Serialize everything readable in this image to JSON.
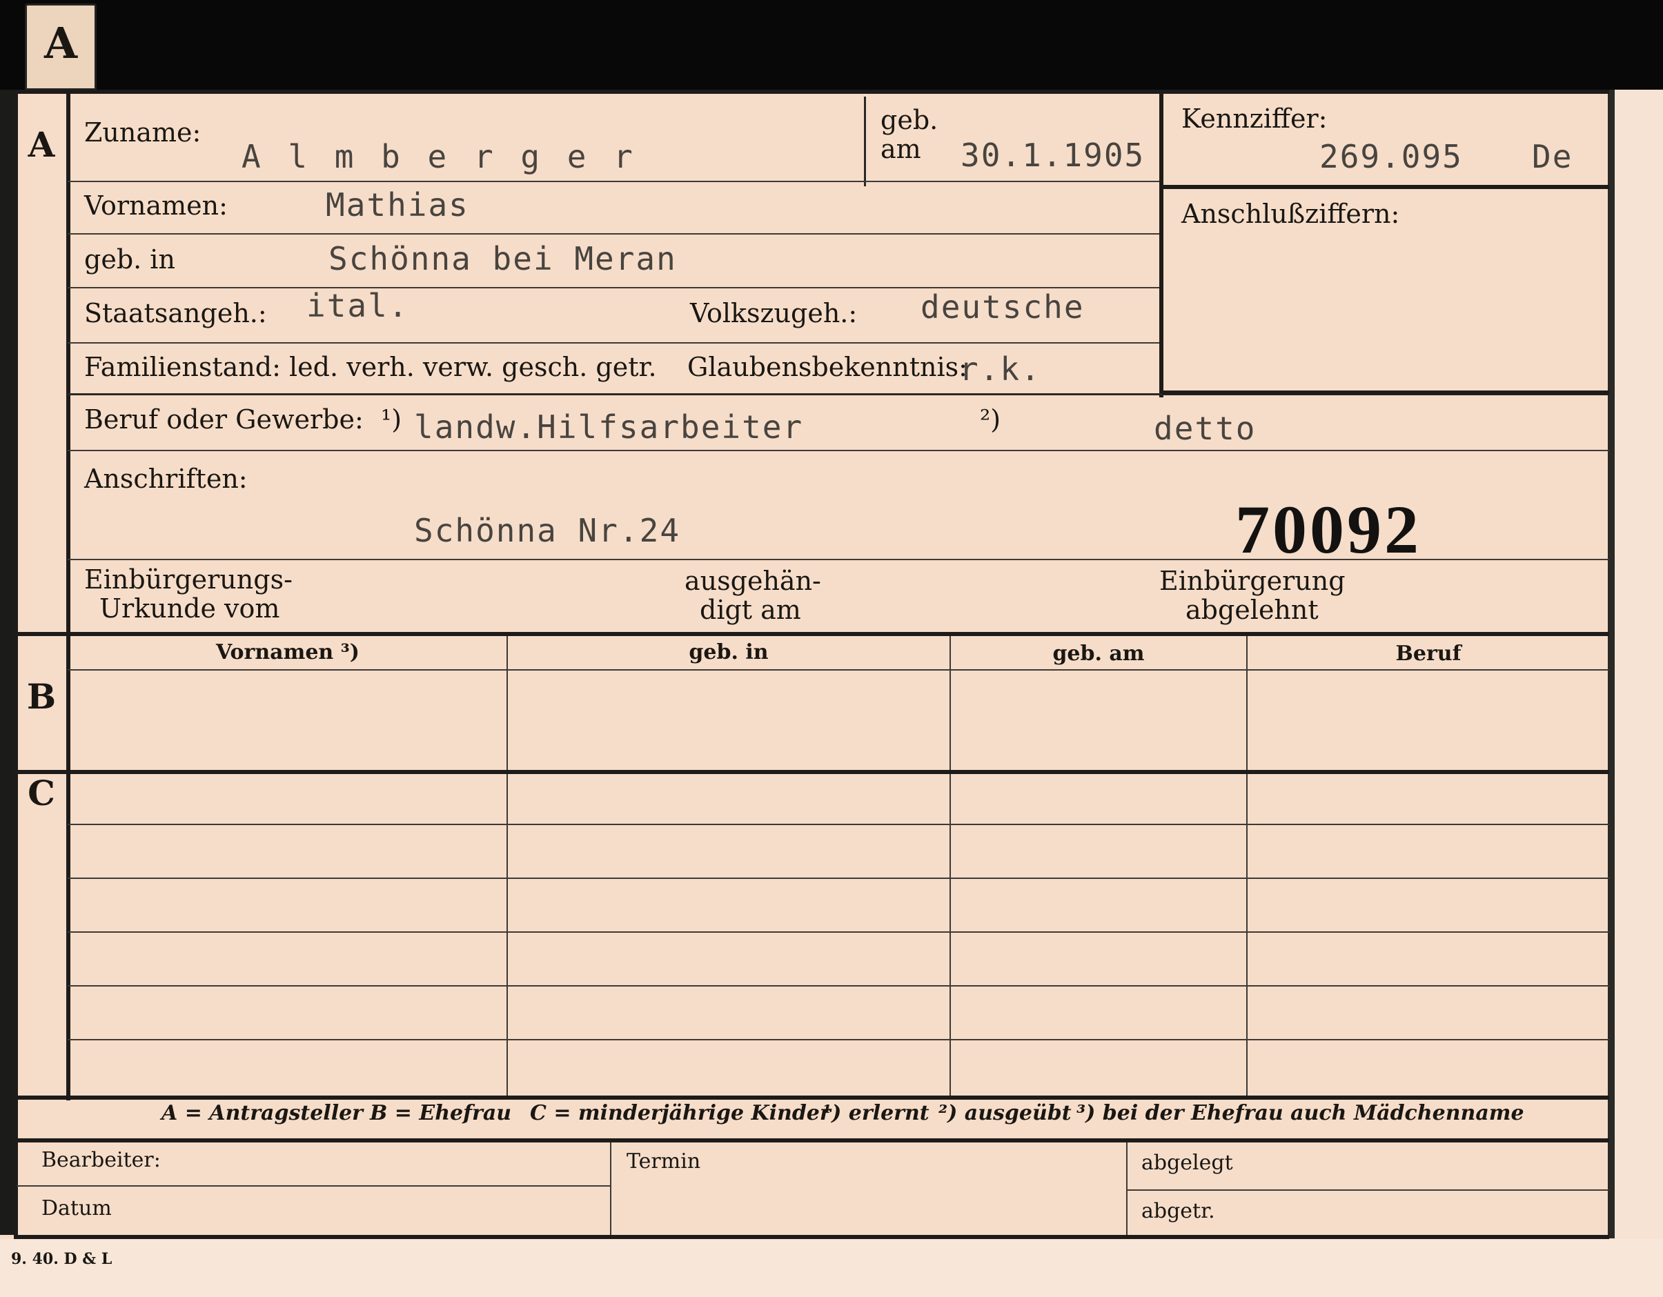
{
  "tab": {
    "letter": "A"
  },
  "sections": {
    "a": "A",
    "b": "B",
    "c": "C"
  },
  "applicant": {
    "surname": {
      "label": "Zuname:",
      "value": "A l m b e r g e r"
    },
    "birth_date": {
      "label_top": "geb.",
      "label_bottom": "am",
      "value": "30.1.1905"
    },
    "reference": {
      "label": "Kennziffer:",
      "value": "269.095",
      "suffix": "De"
    },
    "linked_numbers": {
      "label": "Anschlußziffern:"
    },
    "first_names": {
      "label": "Vornamen:",
      "value": "Mathias"
    },
    "birthplace": {
      "label": "geb. in",
      "value": "Schönna bei Meran"
    },
    "citizenship": {
      "label": "Staatsangeh.:",
      "value": "ital."
    },
    "ethnicity": {
      "label": "Volkszugeh.:",
      "value": "deutsche"
    },
    "marital_status": {
      "label": "Familienstand: led. verh. verw. gesch. getr."
    },
    "religion": {
      "label": "Glaubensbekenntnis:",
      "value": "r.k."
    },
    "occupation": {
      "label": "Beruf oder Gewerbe:",
      "note1": "¹)",
      "value1": "landw.Hilfsarbeiter",
      "note2": "²)",
      "value2": "detto"
    },
    "addresses": {
      "label": "Anschriften:",
      "value": "Schönna Nr.24"
    },
    "stamp_number": "70092",
    "naturalization": {
      "certificate_line1": "Einbürgerungs-",
      "certificate_line2": "Urkunde vom",
      "delivered_line1": "ausgehän-",
      "delivered_line2": "digt am",
      "refused_line1": "Einbürgerung",
      "refused_line2": "abgelehnt"
    }
  },
  "family_table": {
    "headers": [
      "Vornamen ³)",
      "geb. in",
      "geb. am",
      "Beruf"
    ]
  },
  "legend": {
    "a": "A = Antragsteller",
    "b": "B = Ehefrau",
    "c": "C = minderjährige Kinder",
    "n1": "¹) erlernt",
    "n2": "²) ausgeübt",
    "n3": "³) bei der Ehefrau auch Mädchenname"
  },
  "footer": {
    "clerk": "Bearbeiter:",
    "date": "Datum",
    "deadline": "Termin",
    "filed": "abgelegt",
    "removed": "abgetr."
  },
  "imprint": "9. 40. D & L"
}
